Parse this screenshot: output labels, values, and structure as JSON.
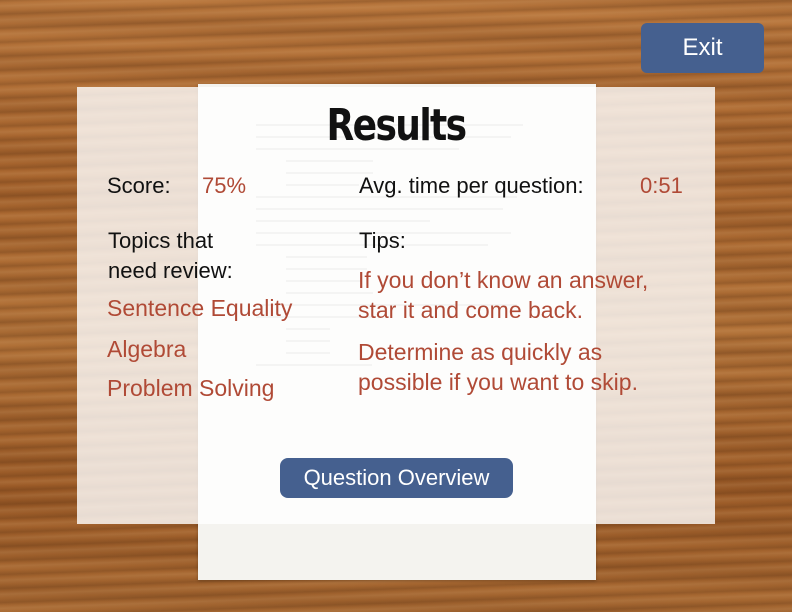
{
  "header": {
    "title": "Results",
    "exit_label": "Exit"
  },
  "stats": {
    "score_label": "Score:",
    "score_value": "75%",
    "avg_time_label": "Avg. time per question:",
    "avg_time_value": "0:51"
  },
  "topics": {
    "heading_line1": "Topics that",
    "heading_line2": "need review:",
    "items": [
      "Sentence Equality",
      "Algebra",
      "Problem Solving"
    ]
  },
  "tips": {
    "heading": "Tips:",
    "items": [
      {
        "line1": "If you don’t know an answer,",
        "line2": "star it and come back."
      },
      {
        "line1": "Determine as quickly as",
        "line2": "possible if you want to skip."
      }
    ]
  },
  "actions": {
    "overview_label": "Question Overview"
  },
  "colors": {
    "accent_red": "#b04a36",
    "button_blue": "#45608f"
  }
}
